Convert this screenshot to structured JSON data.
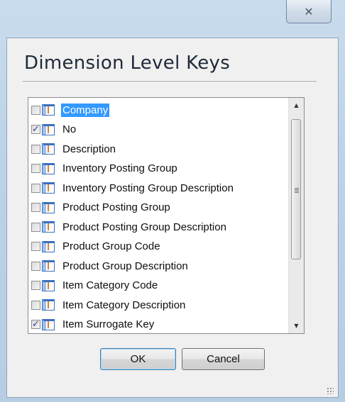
{
  "window": {
    "close_glyph": "✕"
  },
  "dialog": {
    "title": "Dimension Level Keys"
  },
  "list": {
    "items": [
      {
        "label": "Company",
        "checked": false,
        "selected": true
      },
      {
        "label": "No",
        "checked": true,
        "selected": false
      },
      {
        "label": "Description",
        "checked": false,
        "selected": false
      },
      {
        "label": "Inventory Posting Group",
        "checked": false,
        "selected": false
      },
      {
        "label": "Inventory Posting Group Description",
        "checked": false,
        "selected": false
      },
      {
        "label": "Product Posting Group",
        "checked": false,
        "selected": false
      },
      {
        "label": "Product Posting Group Description",
        "checked": false,
        "selected": false
      },
      {
        "label": "Product Group Code",
        "checked": false,
        "selected": false
      },
      {
        "label": "Product Group Description",
        "checked": false,
        "selected": false
      },
      {
        "label": "Item Category Code",
        "checked": false,
        "selected": false
      },
      {
        "label": "Item Category Description",
        "checked": false,
        "selected": false
      },
      {
        "label": "Item Surrogate Key",
        "checked": true,
        "selected": false
      }
    ],
    "scroll_up_glyph": "▲",
    "scroll_down_glyph": "▼"
  },
  "buttons": {
    "ok_label": "OK",
    "cancel_label": "Cancel"
  },
  "colors": {
    "selection": "#3399ff",
    "check": "#3b3b8f"
  },
  "icons": {
    "field_icon": "table-field-icon"
  }
}
